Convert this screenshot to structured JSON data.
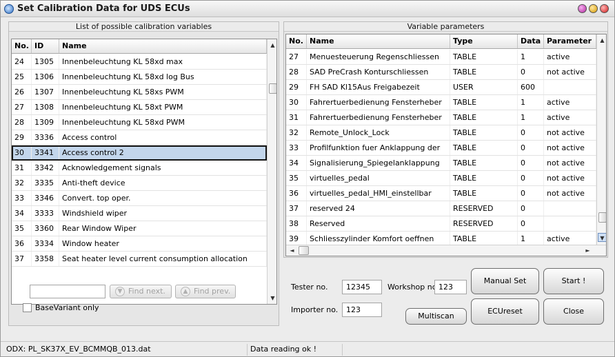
{
  "window": {
    "title": "Set Calibration Data for UDS ECUs"
  },
  "left_panel": {
    "title": "List of possible calibration variables",
    "columns": [
      "No.",
      "ID",
      "Name"
    ],
    "rows": [
      {
        "no": "24",
        "id": "1305",
        "name": "Innenbeleuchtung KL 58xd max"
      },
      {
        "no": "25",
        "id": "1306",
        "name": "Innenbeleuchtung KL 58xd log Bus"
      },
      {
        "no": "26",
        "id": "1307",
        "name": "Innenbeleuchtung KL 58xs PWM"
      },
      {
        "no": "27",
        "id": "1308",
        "name": "Innenbeleuchtung KL 58xt PWM"
      },
      {
        "no": "28",
        "id": "1309",
        "name": "Innenbeleuchtung KL 58xd PWM"
      },
      {
        "no": "29",
        "id": "3336",
        "name": "Access control"
      },
      {
        "no": "30",
        "id": "3341",
        "name": "Access control 2"
      },
      {
        "no": "31",
        "id": "3342",
        "name": "Acknowledgement signals"
      },
      {
        "no": "32",
        "id": "3335",
        "name": "Anti-theft device"
      },
      {
        "no": "33",
        "id": "3346",
        "name": "Convert. top oper."
      },
      {
        "no": "34",
        "id": "3333",
        "name": "Windshield wiper"
      },
      {
        "no": "35",
        "id": "3360",
        "name": "Rear Window Wiper"
      },
      {
        "no": "36",
        "id": "3334",
        "name": "Window heater"
      },
      {
        "no": "37",
        "id": "3358",
        "name": "Seat heater level current consumption allocation"
      }
    ],
    "selected_row": 6,
    "search_value": "",
    "find_next": "Find next.",
    "find_prev": "Find prev.",
    "base_variant_label": "BaseVariant only",
    "base_variant_checked": false
  },
  "right_panel": {
    "title": "Variable parameters",
    "columns": [
      "No.",
      "Name",
      "Type",
      "Data",
      "Parameter"
    ],
    "rows": [
      {
        "no": "27",
        "name": "Menuesteuerung Regenschliessen",
        "type": "TABLE",
        "data": "1",
        "param": "active"
      },
      {
        "no": "28",
        "name": "SAD PreCrash Konturschliessen",
        "type": "TABLE",
        "data": "0",
        "param": "not active"
      },
      {
        "no": "29",
        "name": "FH SAD Kl15Aus Freigabezeit",
        "type": "USER",
        "data": "600",
        "param": ""
      },
      {
        "no": "30",
        "name": "Fahrertuerbedienung Fensterheber",
        "type": "TABLE",
        "data": "1",
        "param": "active"
      },
      {
        "no": "31",
        "name": "Fahrertuerbedienung Fensterheber",
        "type": "TABLE",
        "data": "1",
        "param": "active"
      },
      {
        "no": "32",
        "name": "Remote_Unlock_Lock",
        "type": "TABLE",
        "data": "0",
        "param": "not active"
      },
      {
        "no": "33",
        "name": "Profilfunktion fuer Anklappung der",
        "type": "TABLE",
        "data": "0",
        "param": "not active"
      },
      {
        "no": "34",
        "name": "Signalisierung_Spiegelanklappung",
        "type": "TABLE",
        "data": "0",
        "param": "not active"
      },
      {
        "no": "35",
        "name": "virtuelles_pedal",
        "type": "TABLE",
        "data": "0",
        "param": "not active"
      },
      {
        "no": "36",
        "name": "virtuelles_pedal_HMI_einstellbar",
        "type": "TABLE",
        "data": "0",
        "param": "not active"
      },
      {
        "no": "37",
        "name": "reserved 24",
        "type": "RESERVED",
        "data": "0",
        "param": ""
      },
      {
        "no": "38",
        "name": "Reserved",
        "type": "RESERVED",
        "data": "0",
        "param": ""
      },
      {
        "no": "39",
        "name": "Schliesszylinder Komfort oeffnen",
        "type": "TABLE",
        "data": "1",
        "param": "active"
      }
    ]
  },
  "form": {
    "tester_label": "Tester no.",
    "tester_value": "12345",
    "workshop_label": "Workshop nc",
    "workshop_value": "123",
    "importer_label": "Importer no.",
    "importer_value": "123"
  },
  "buttons": {
    "manual_set": "Manual Set",
    "start": "Start !",
    "multiscan": "Multiscan",
    "ecureset": "ECUreset",
    "close": "Close"
  },
  "status": {
    "odx": "ODX: PL_SK37X_EV_BCMMQB_013.dat",
    "message": "Data reading ok !"
  }
}
